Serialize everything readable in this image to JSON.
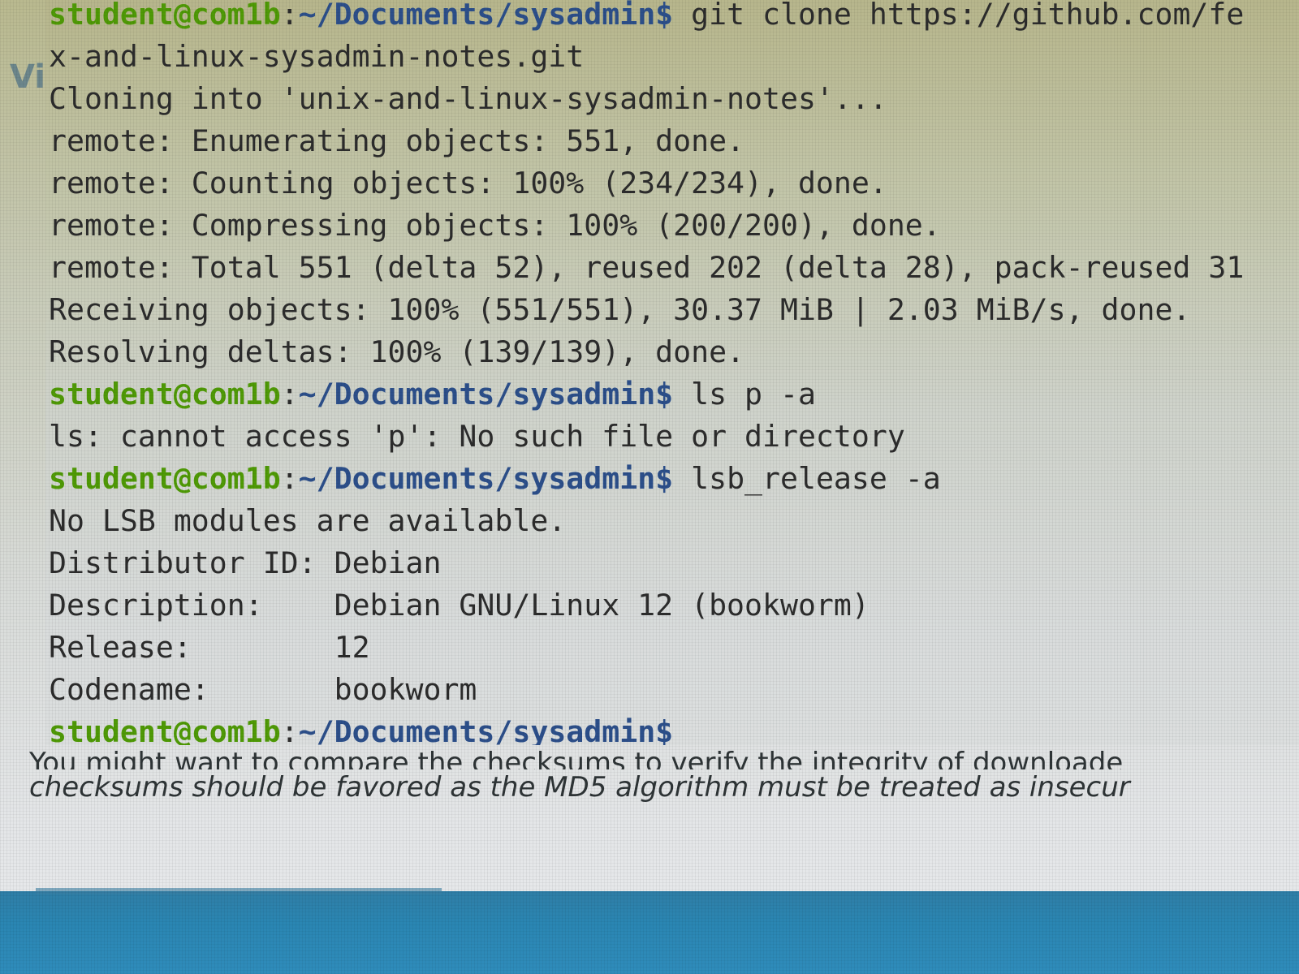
{
  "page": {
    "partial_heading": "Vi",
    "text_line_1": "You might want to compare the checksums to verify the integrity of downloade",
    "text_line_2": "checksums should be favored as the MD5 algorithm must be treated as insecur"
  },
  "terminal": {
    "prompt": {
      "user_host": "student@com1b",
      "colon": ":",
      "path": "~/Documents/sysadmin$"
    },
    "lines": [
      {
        "kind": "prompt",
        "command": " git clone https://github.com/fe"
      },
      {
        "kind": "output",
        "text": "x-and-linux-sysadmin-notes.git"
      },
      {
        "kind": "output",
        "text": "Cloning into 'unix-and-linux-sysadmin-notes'..."
      },
      {
        "kind": "output",
        "text": "remote: Enumerating objects: 551, done."
      },
      {
        "kind": "output",
        "text": "remote: Counting objects: 100% (234/234), done."
      },
      {
        "kind": "output",
        "text": "remote: Compressing objects: 100% (200/200), done."
      },
      {
        "kind": "output",
        "text": "remote: Total 551 (delta 52), reused 202 (delta 28), pack-reused 31"
      },
      {
        "kind": "output",
        "text": "Receiving objects: 100% (551/551), 30.37 MiB | 2.03 MiB/s, done."
      },
      {
        "kind": "output",
        "text": "Resolving deltas: 100% (139/139), done."
      },
      {
        "kind": "prompt",
        "command": " ls p -a"
      },
      {
        "kind": "output",
        "text": "ls: cannot access 'p': No such file or directory"
      },
      {
        "kind": "prompt",
        "command": " lsb_release -a"
      },
      {
        "kind": "output",
        "text": "No LSB modules are available."
      },
      {
        "kind": "output",
        "text": "Distributor ID:\tDebian"
      },
      {
        "kind": "output",
        "text": "Description:\tDebian GNU/Linux 12 (bookworm)"
      },
      {
        "kind": "output",
        "text": "Release:\t12"
      },
      {
        "kind": "output",
        "text": "Codename:\tbookworm"
      },
      {
        "kind": "prompt",
        "command": ""
      }
    ]
  }
}
